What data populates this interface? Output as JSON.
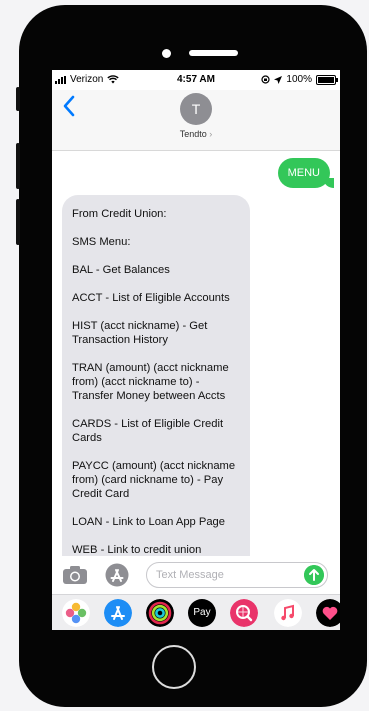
{
  "status": {
    "carrier": "Verizon",
    "time": "4:57 AM",
    "battery": "100%"
  },
  "header": {
    "avatar_initial": "T",
    "contact_name": "Tendto",
    "contact_chevron": "›"
  },
  "thread": {
    "sent": "MENU",
    "received_lines": [
      "From Credit Union:",
      "SMS Menu:",
      "BAL - Get Balances",
      "ACCT - List of Eligible Accounts",
      "HIST (acct nickname) - Get Transaction History",
      "TRAN (amount) (acct nickname from) (acct nickname to) - Transfer Money between Accts",
      "CARDS - List of Eligible Credit Cards",
      "PAYCC (amount) (acct nickname from) (card nickname to) - Pay Credit Card",
      "LOAN - Link to Loan App Page",
      "WEB - Link to credit union website"
    ]
  },
  "composer": {
    "placeholder": "Text Message"
  },
  "tray": {
    "applepay_label": "Pay"
  },
  "colors": {
    "accent": "#33c759",
    "link": "#007aff",
    "bubble": "#e5e5ea"
  },
  "icons": [
    "back-icon",
    "camera-icon",
    "app-store-icon",
    "send-icon",
    "photos-icon",
    "activity-icon",
    "apple-pay-icon",
    "search-images-icon",
    "music-icon",
    "heart-icon"
  ]
}
